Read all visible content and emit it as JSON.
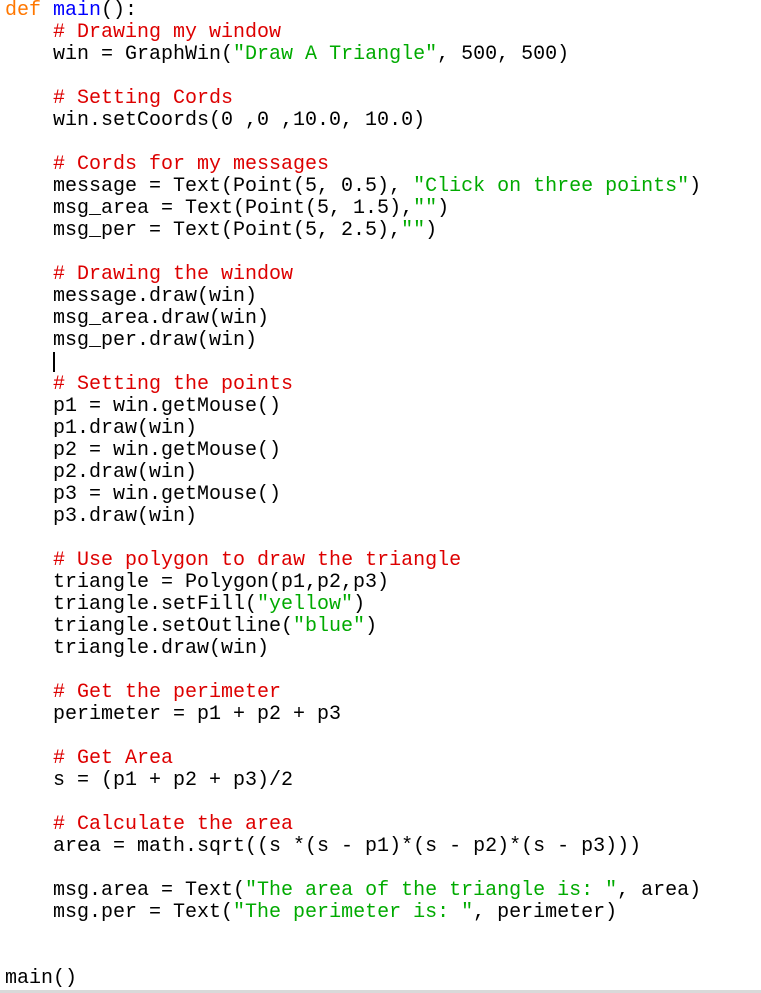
{
  "editor": {
    "colors": {
      "keyword": "#ff7700",
      "defname": "#0000ff",
      "comment": "#dd0000",
      "string": "#00aa00",
      "text": "#000000"
    },
    "lines": [
      [
        {
          "t": "kw",
          "v": "def"
        },
        {
          "t": "",
          "v": " "
        },
        {
          "t": "fn",
          "v": "main"
        },
        {
          "t": "",
          "v": "():"
        }
      ],
      [
        {
          "t": "",
          "v": "    "
        },
        {
          "t": "cm",
          "v": "# Drawing my window"
        }
      ],
      [
        {
          "t": "",
          "v": "    win = GraphWin("
        },
        {
          "t": "st",
          "v": "\"Draw A Triangle\""
        },
        {
          "t": "",
          "v": ", 500, 500)"
        }
      ],
      [],
      [
        {
          "t": "",
          "v": "    "
        },
        {
          "t": "cm",
          "v": "# Setting Cords"
        }
      ],
      [
        {
          "t": "",
          "v": "    win.setCoords(0 ,0 ,10.0, 10.0)"
        }
      ],
      [],
      [
        {
          "t": "",
          "v": "    "
        },
        {
          "t": "cm",
          "v": "# Cords for my messages"
        }
      ],
      [
        {
          "t": "",
          "v": "    message = Text(Point(5, 0.5), "
        },
        {
          "t": "st",
          "v": "\"Click on three points\""
        },
        {
          "t": "",
          "v": ")"
        }
      ],
      [
        {
          "t": "",
          "v": "    msg_area = Text(Point(5, 1.5),"
        },
        {
          "t": "st",
          "v": "\"\""
        },
        {
          "t": "",
          "v": ")"
        }
      ],
      [
        {
          "t": "",
          "v": "    msg_per = Text(Point(5, 2.5),"
        },
        {
          "t": "st",
          "v": "\"\""
        },
        {
          "t": "",
          "v": ")"
        }
      ],
      [],
      [
        {
          "t": "",
          "v": "    "
        },
        {
          "t": "cm",
          "v": "# Drawing the window"
        }
      ],
      [
        {
          "t": "",
          "v": "    message.draw(win)"
        }
      ],
      [
        {
          "t": "",
          "v": "    msg_area.draw(win)"
        }
      ],
      [
        {
          "t": "",
          "v": "    msg_per.draw(win)"
        }
      ],
      "CURSOR",
      [
        {
          "t": "",
          "v": "    "
        },
        {
          "t": "cm",
          "v": "# Setting the points"
        }
      ],
      [
        {
          "t": "",
          "v": "    p1 = win.getMouse()"
        }
      ],
      [
        {
          "t": "",
          "v": "    p1.draw(win)"
        }
      ],
      [
        {
          "t": "",
          "v": "    p2 = win.getMouse()"
        }
      ],
      [
        {
          "t": "",
          "v": "    p2.draw(win)"
        }
      ],
      [
        {
          "t": "",
          "v": "    p3 = win.getMouse()"
        }
      ],
      [
        {
          "t": "",
          "v": "    p3.draw(win)"
        }
      ],
      [],
      [
        {
          "t": "",
          "v": "    "
        },
        {
          "t": "cm",
          "v": "# Use polygon to draw the triangle"
        }
      ],
      [
        {
          "t": "",
          "v": "    triangle = Polygon(p1,p2,p3)"
        }
      ],
      [
        {
          "t": "",
          "v": "    triangle.setFill("
        },
        {
          "t": "st",
          "v": "\"yellow\""
        },
        {
          "t": "",
          "v": ")"
        }
      ],
      [
        {
          "t": "",
          "v": "    triangle.setOutline("
        },
        {
          "t": "st",
          "v": "\"blue\""
        },
        {
          "t": "",
          "v": ")"
        }
      ],
      [
        {
          "t": "",
          "v": "    triangle.draw(win)"
        }
      ],
      [],
      [
        {
          "t": "",
          "v": "    "
        },
        {
          "t": "cm",
          "v": "# Get the perimeter"
        }
      ],
      [
        {
          "t": "",
          "v": "    perimeter = p1 + p2 + p3"
        }
      ],
      [],
      [
        {
          "t": "",
          "v": "    "
        },
        {
          "t": "cm",
          "v": "# Get Area"
        }
      ],
      [
        {
          "t": "",
          "v": "    s = (p1 + p2 + p3)/2"
        }
      ],
      [],
      [
        {
          "t": "",
          "v": "    "
        },
        {
          "t": "cm",
          "v": "# Calculate the area"
        }
      ],
      [
        {
          "t": "",
          "v": "    area = math.sqrt((s *(s - p1)*(s - p2)*(s - p3)))"
        }
      ],
      [],
      [
        {
          "t": "",
          "v": "    msg.area = Text("
        },
        {
          "t": "st",
          "v": "\"The area of the triangle is: \""
        },
        {
          "t": "",
          "v": ", area)"
        }
      ],
      [
        {
          "t": "",
          "v": "    msg.per = Text("
        },
        {
          "t": "st",
          "v": "\"The perimeter is: \""
        },
        {
          "t": "",
          "v": ", perimeter)"
        }
      ],
      [],
      [],
      [
        {
          "t": "",
          "v": "main()"
        }
      ]
    ]
  }
}
